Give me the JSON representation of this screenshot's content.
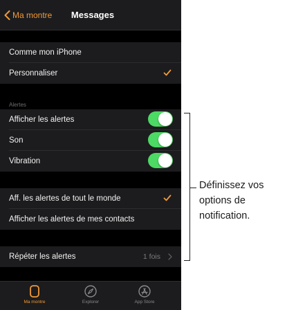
{
  "navbar": {
    "back_label": "Ma montre",
    "title": "Messages"
  },
  "options": {
    "mirror_label": "Comme mon iPhone",
    "custom_label": "Personnaliser",
    "custom_checked": true
  },
  "alerts": {
    "header": "Alertes",
    "show_alerts_label": "Afficher les alertes",
    "show_alerts_on": true,
    "sound_label": "Son",
    "sound_on": true,
    "vibration_label": "Vibration",
    "vibration_on": true
  },
  "filter": {
    "everyone_label": "Aff. les alertes de tout le monde",
    "everyone_checked": true,
    "contacts_label": "Afficher les alertes de mes contacts"
  },
  "repeat": {
    "label": "Répéter les alertes",
    "value": "1 fois"
  },
  "tabbar": {
    "tabs": [
      {
        "label": "Ma montre",
        "icon": "watch-icon",
        "active": true
      },
      {
        "label": "Explorer",
        "icon": "compass-icon",
        "active": false
      },
      {
        "label": "App Store",
        "icon": "app-store-icon",
        "active": false
      }
    ]
  },
  "callout": {
    "line1": "Définissez vos",
    "line2": "options de",
    "line3": "notification."
  },
  "colors": {
    "accent": "#f19a38",
    "toggle_on": "#4cd964",
    "cell_background": "#1c1c1e",
    "screen_background": "#000000"
  }
}
